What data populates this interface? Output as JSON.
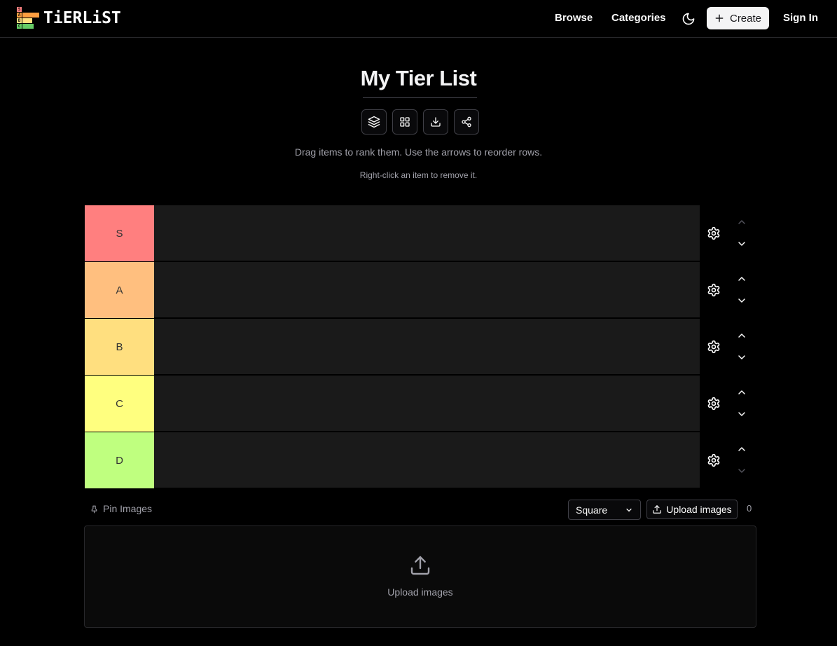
{
  "header": {
    "logo_text": "TiERLiST",
    "logo_letters": [
      "S",
      "A",
      "B",
      "C"
    ],
    "nav": {
      "browse": "Browse",
      "categories": "Categories",
      "create": "Create",
      "sign_in": "Sign In"
    }
  },
  "page": {
    "title": "My Tier List",
    "hint_primary": "Drag items to rank them. Use the arrows to reorder rows.",
    "hint_secondary": "Right-click an item to remove it."
  },
  "toolbar": {
    "icons": [
      "layers-icon",
      "grid-icon",
      "download-icon",
      "share-icon"
    ]
  },
  "tiers": [
    {
      "label": "S",
      "color": "#ff7f7f",
      "can_move_up": false,
      "can_move_down": true
    },
    {
      "label": "A",
      "color": "#ffbf7f",
      "can_move_up": true,
      "can_move_down": true
    },
    {
      "label": "B",
      "color": "#ffdf7f",
      "can_move_up": true,
      "can_move_down": true
    },
    {
      "label": "C",
      "color": "#ffff7f",
      "can_move_up": true,
      "can_move_down": true
    },
    {
      "label": "D",
      "color": "#bfff7f",
      "can_move_up": true,
      "can_move_down": false
    }
  ],
  "controls": {
    "pin_label": "Pin Images",
    "shape_selected": "Square",
    "upload_button": "Upload images",
    "image_count": "0"
  },
  "dropzone": {
    "label": "Upload images"
  },
  "colors": {
    "background": "#000000",
    "tier_row_bg": "#1a1a1a",
    "muted_text": "#a1a1aa",
    "border": "#3f3f46"
  }
}
